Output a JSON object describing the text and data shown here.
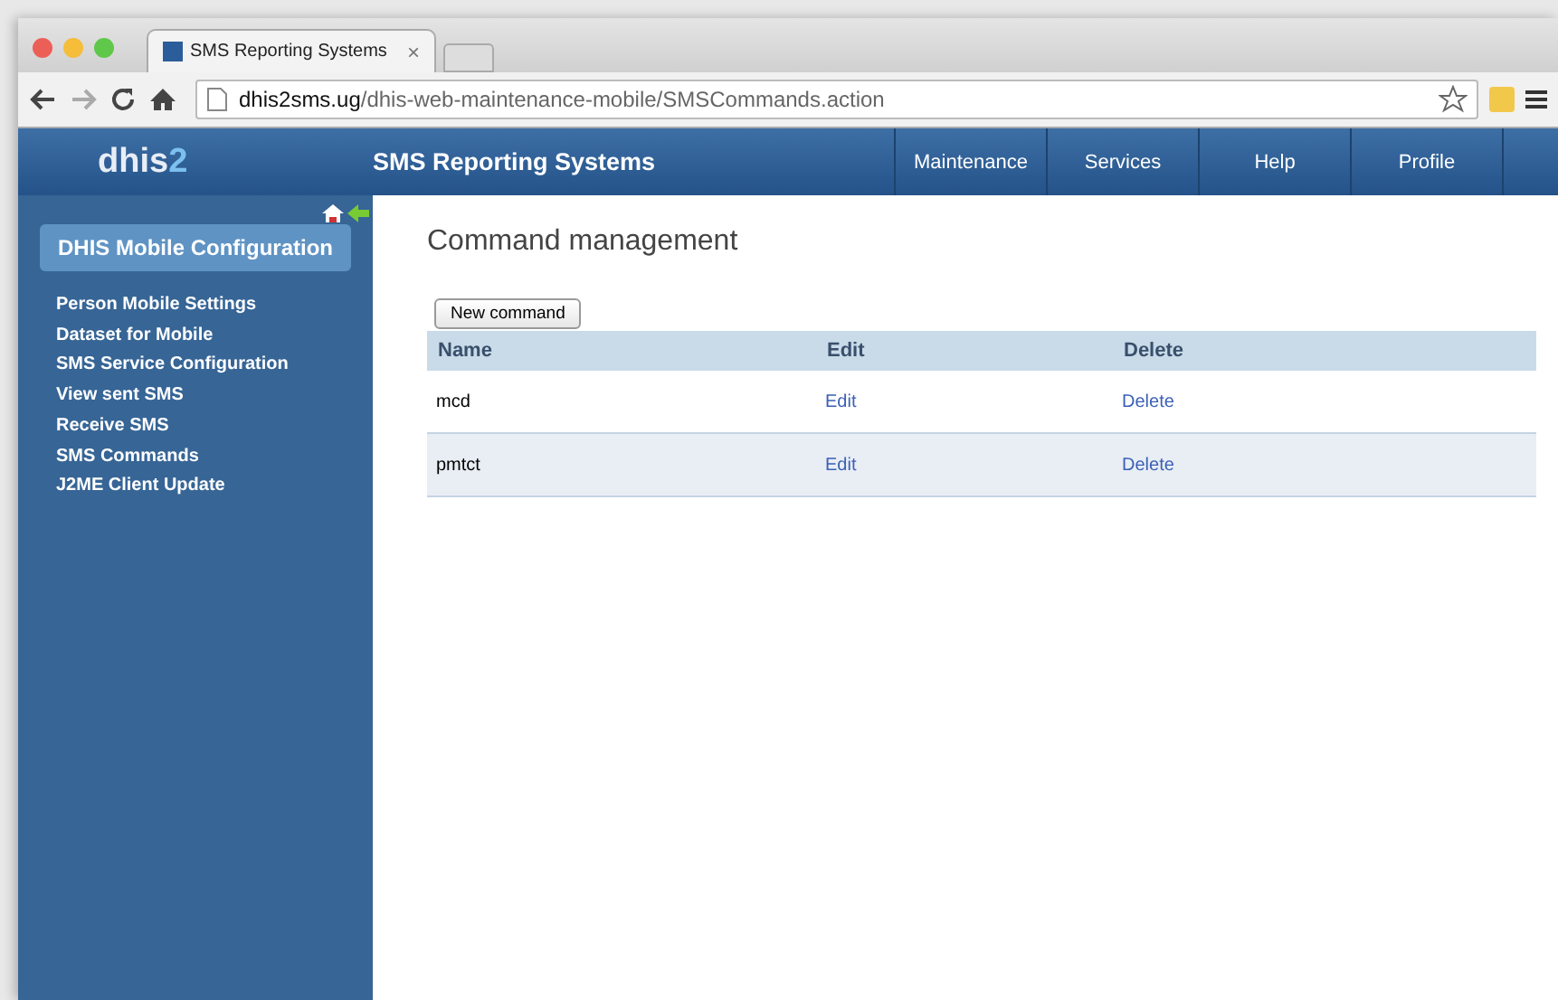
{
  "browser": {
    "tab_title": "SMS Reporting Systems",
    "tab_close": "×",
    "url_host": "dhis2sms.ug",
    "url_path": "/dhis-web-maintenance-mobile/SMSCommands.action"
  },
  "header": {
    "logo_main": "dhis",
    "logo_digit": "2",
    "title": "SMS Reporting Systems",
    "menu": [
      {
        "label": "Maintenance"
      },
      {
        "label": "Services"
      },
      {
        "label": "Help"
      },
      {
        "label": "Profile"
      }
    ]
  },
  "sidebar": {
    "heading": "DHIS Mobile Configuration",
    "items": [
      {
        "label": "Person Mobile Settings"
      },
      {
        "label": "Dataset for Mobile"
      },
      {
        "label": "SMS Service Configuration"
      },
      {
        "label": "View sent SMS"
      },
      {
        "label": "Receive SMS"
      },
      {
        "label": "SMS Commands"
      },
      {
        "label": "J2ME Client Update"
      }
    ]
  },
  "content": {
    "title": "Command management",
    "new_button": "New command",
    "table": {
      "columns": [
        "Name",
        "Edit",
        "Delete"
      ],
      "rows": [
        {
          "name": "mcd",
          "edit": "Edit",
          "delete": "Delete"
        },
        {
          "name": "pmtct",
          "edit": "Edit",
          "delete": "Delete"
        }
      ]
    }
  }
}
